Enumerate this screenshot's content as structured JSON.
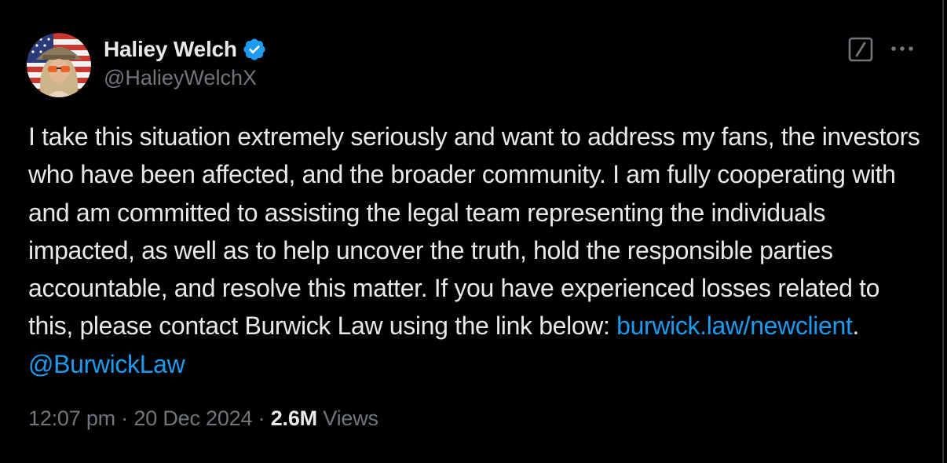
{
  "author": {
    "name": "Haliey Welch",
    "handle": "@HalieyWelchX",
    "verified_color": "#1d9bf0"
  },
  "actions": {
    "grok_icon": "grok-slash-icon",
    "more_icon": "more-dots-icon"
  },
  "tweet": {
    "text_before_links": "I take this situation extremely seriously and want to address my fans, the investors who have been affected, and the broader community. I am fully cooperating with and am committed to assisting the legal team representing the individuals impacted, as well as to help uncover the truth, hold the responsible parties accountable, and resolve this matter. If you have experienced losses related to this, please contact Burwick Law using the link below: ",
    "link_url_text": "burwick.law/newclient",
    "between_links": ". ",
    "mention": "@BurwickLaw"
  },
  "meta": {
    "time": "12:07 pm",
    "separator": " · ",
    "date": "20 Dec 2024",
    "views_count": "2.6M",
    "views_label": "Views"
  },
  "colors": {
    "background": "#000000",
    "text": "#e7e9ea",
    "secondary": "#71767b",
    "link": "#1d9bf0"
  }
}
